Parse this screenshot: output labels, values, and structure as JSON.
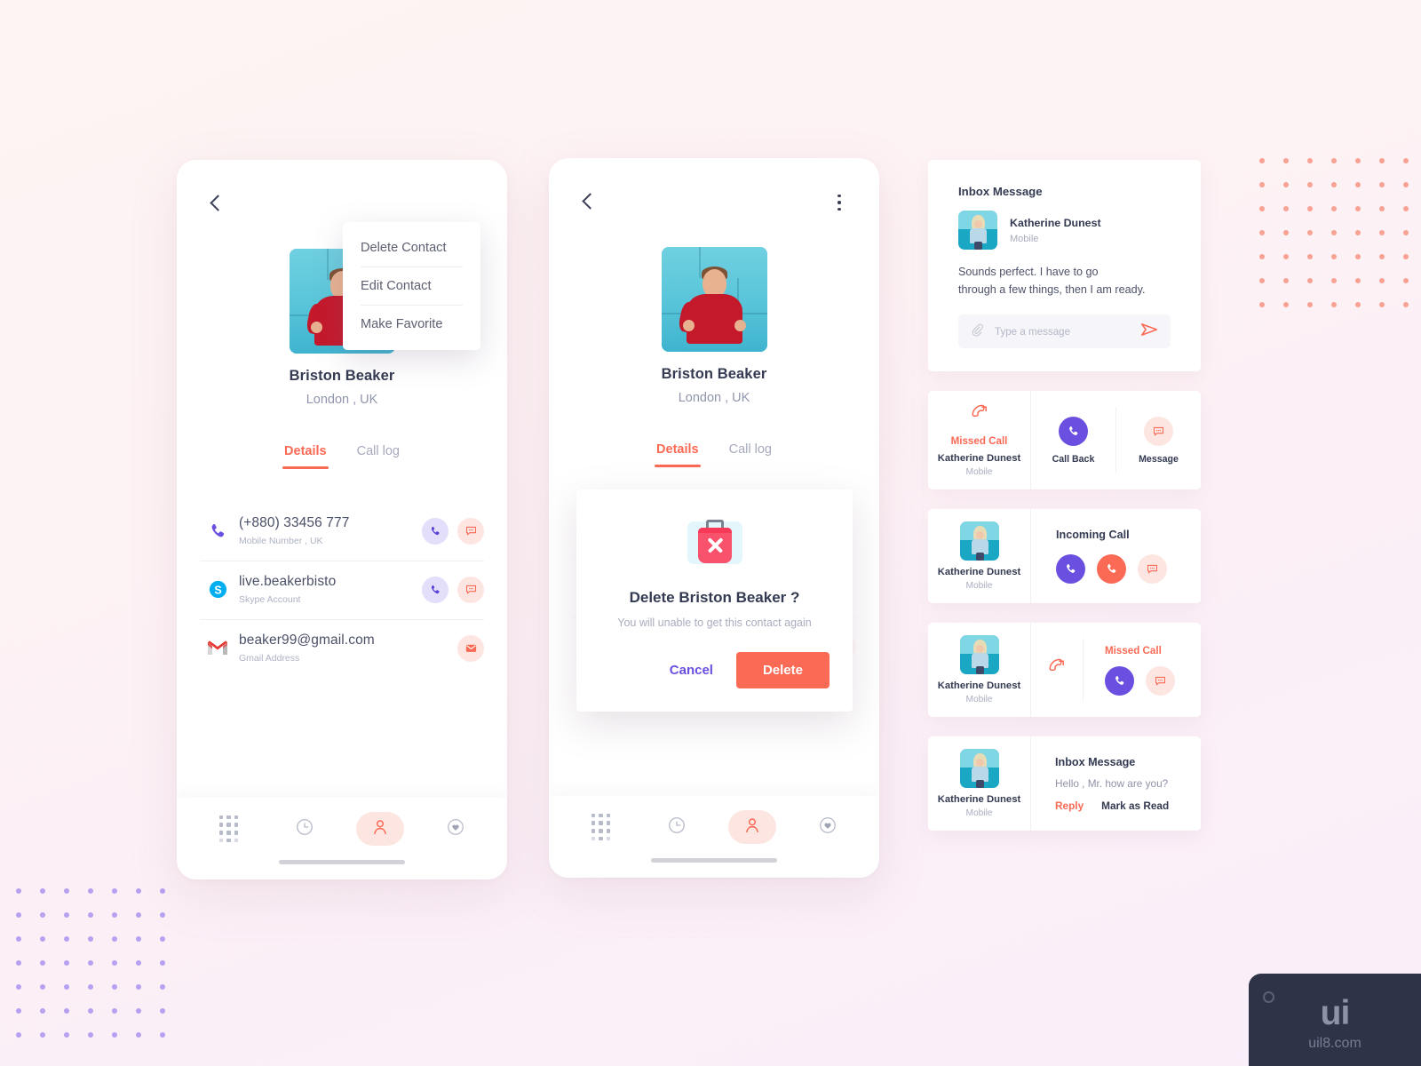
{
  "theme": {
    "coral": "#fa6a55",
    "purple": "#6b4fe0",
    "dark": "#333a52",
    "muted": "#a9adbf",
    "bg_gradient_start": "#fdf4f3",
    "bg_gradient_end": "#faeefa",
    "dot_coral": "#f8a294",
    "dot_purple": "#a18bf0"
  },
  "contact_screen": {
    "back_icon": "chevron-left-icon",
    "kebab_icon": "more-vertical-icon",
    "name": "Briston Beaker",
    "location": "London , UK",
    "tabs": [
      {
        "label": "Details",
        "active": true
      },
      {
        "label": "Call log",
        "active": false
      }
    ],
    "rows": [
      {
        "icon": "phone-icon",
        "value": "(+880) 33456 777",
        "subtitle": "Mobile Number , UK",
        "actions": [
          "call-icon",
          "message-icon"
        ]
      },
      {
        "icon": "skype-icon",
        "value": "live.beakerbisto",
        "subtitle": "Skype Account",
        "actions": [
          "call-icon",
          "message-icon"
        ]
      },
      {
        "icon": "gmail-icon",
        "value": "beaker99@gmail.com",
        "subtitle": "Gmail Address",
        "actions": [
          "mail-icon"
        ]
      }
    ],
    "bottom_nav": [
      {
        "icon": "dialpad-icon",
        "selected": false
      },
      {
        "icon": "clock-icon",
        "selected": false
      },
      {
        "icon": "person-icon",
        "selected": true
      },
      {
        "icon": "heart-icon",
        "selected": false
      }
    ]
  },
  "context_menu": {
    "items": [
      {
        "label": "Delete Contact"
      },
      {
        "label": "Edit Contact"
      },
      {
        "label": "Make Favorite"
      }
    ]
  },
  "delete_dialog": {
    "icon": "trash-x-icon",
    "title": "Delete Briston Beaker ?",
    "subtitle": "You will unable to get this contact again",
    "cancel_label": "Cancel",
    "delete_label": "Delete"
  },
  "right_column": {
    "inbox_card": {
      "title": "Inbox Message",
      "avatar": "katherine-avatar",
      "sender": "Katherine Dunest",
      "sender_sub": "Mobile",
      "body_line_1": "Sounds perfect. I have to go",
      "body_line_2": "through a few things, then I am ready.",
      "input_placeholder": "Type a message",
      "attach_icon": "paperclip-icon",
      "send_icon": "send-icon"
    },
    "missed_call_card": {
      "icon": "missed-call-icon",
      "status": "Missed Call",
      "name": "Katherine Dunest",
      "sub": "Mobile",
      "actions": [
        {
          "icon": "call-icon",
          "label": "Call Back",
          "style": "solid-purple"
        },
        {
          "icon": "message-icon",
          "label": "Message",
          "style": "pink-soft"
        }
      ]
    },
    "incoming_call_card": {
      "avatar": "katherine-avatar",
      "name": "Katherine Dunest",
      "sub": "Mobile",
      "title": "Incoming Call",
      "buttons": [
        "accept-call-icon",
        "decline-call-icon",
        "message-icon"
      ]
    },
    "missed_call_avatar_card": {
      "avatar": "katherine-avatar",
      "name": "Katherine Dunest",
      "sub": "Mobile",
      "icon": "missed-call-icon",
      "status": "Missed Call",
      "buttons": [
        "call-back-icon",
        "message-icon"
      ]
    },
    "inbox_small_card": {
      "avatar": "katherine-avatar",
      "name": "Katherine Dunest",
      "sub": "Mobile",
      "title": "Inbox Message",
      "text": "Hello , Mr.  how are you?",
      "reply_label": "Reply",
      "mark_read_label": "Mark as Read"
    }
  },
  "watermark": {
    "logo": "ui",
    "url": "uil8.com"
  }
}
